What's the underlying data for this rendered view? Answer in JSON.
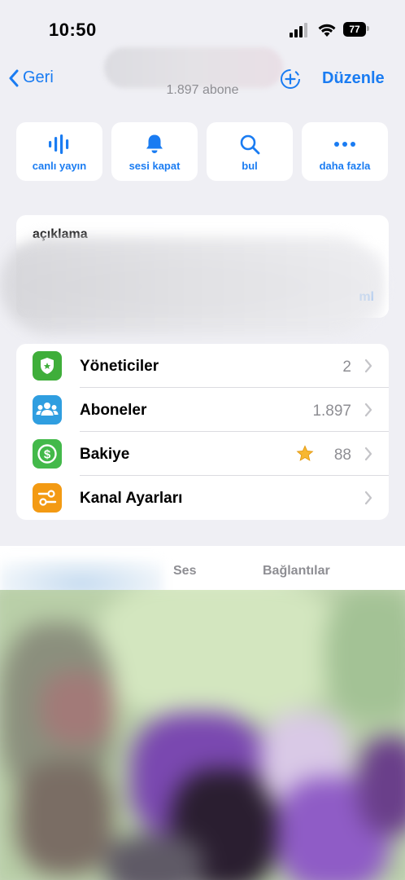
{
  "status_bar": {
    "time": "10:50",
    "battery": "77"
  },
  "nav": {
    "back_label": "Geri",
    "subtitle": "1.897 abone",
    "edit_label": "Düzenle"
  },
  "quick_actions": [
    {
      "label": "canlı yayın",
      "icon": "live-stream-icon"
    },
    {
      "label": "sesi kapat",
      "icon": "bell-icon"
    },
    {
      "label": "bul",
      "icon": "search-icon"
    },
    {
      "label": "daha fazla",
      "icon": "more-icon"
    }
  ],
  "description": {
    "label": "açıklama",
    "more_label": "ml"
  },
  "menu": [
    {
      "label": "Yöneticiler",
      "value": "2",
      "icon": "shield-star-icon",
      "color": "#3fae3a"
    },
    {
      "label": "Aboneler",
      "value": "1.897",
      "icon": "people-icon",
      "color": "#2f9ee0"
    },
    {
      "label": "Bakiye",
      "value": "88",
      "icon": "dollar-coin-icon",
      "color": "#43b94a",
      "value_icon": "star-icon"
    },
    {
      "label": "Kanal Ayarları",
      "value": "",
      "icon": "settings-sliders-icon",
      "color": "#f39a13"
    }
  ],
  "tabs": [
    {
      "label": "Ses"
    },
    {
      "label": "Bağlantılar"
    }
  ],
  "colors": {
    "accent": "#1a7cf2",
    "background": "#efeff4",
    "secondary_text": "#8e8e93"
  }
}
